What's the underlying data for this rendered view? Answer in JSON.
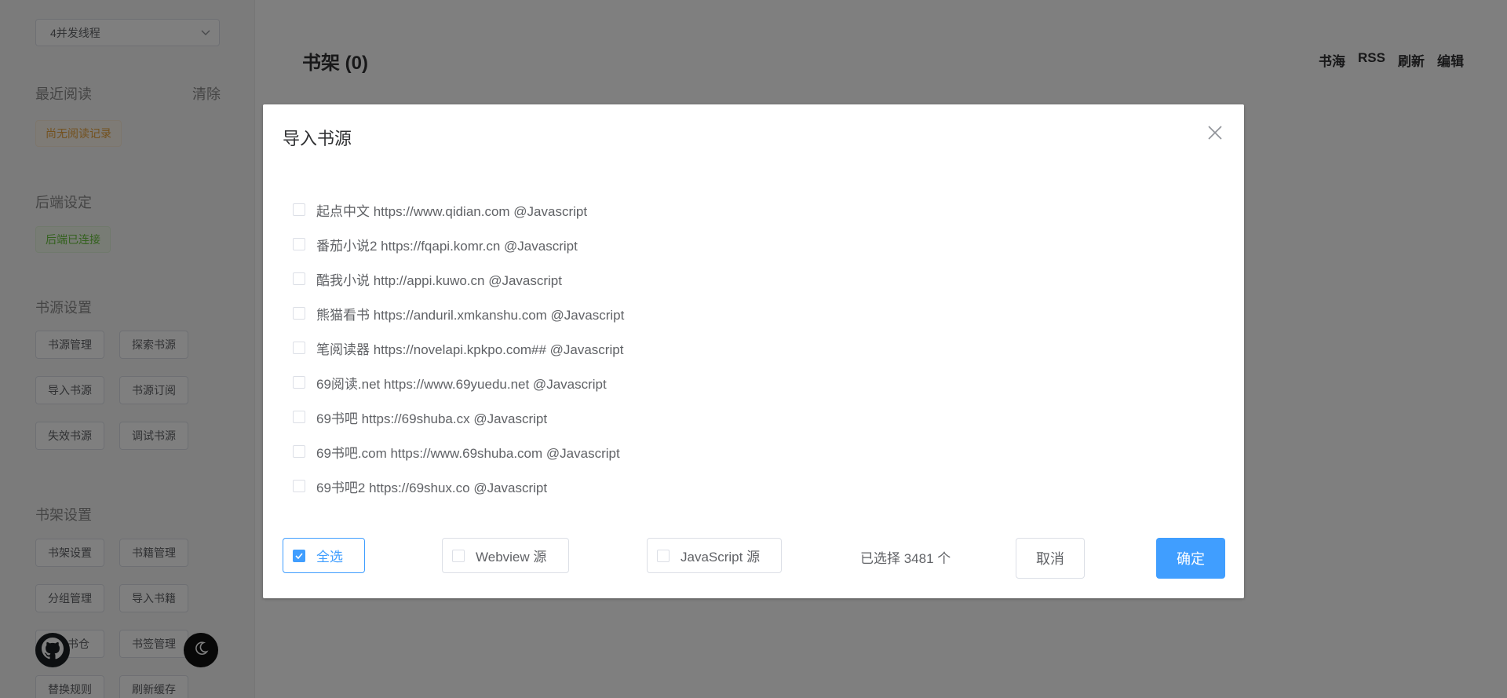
{
  "sidebar": {
    "thread_select": {
      "value": "4并发线程"
    },
    "recent": {
      "title": "最近阅读",
      "clear": "清除",
      "empty_tag": "尚无阅读记录"
    },
    "backend": {
      "title": "后端设定",
      "status_tag": "后端已连接"
    },
    "source_settings": {
      "title": "书源设置",
      "buttons": [
        "书源管理",
        "探索书源",
        "导入书源",
        "书源订阅",
        "失效书源",
        "调试书源"
      ]
    },
    "shelf_settings": {
      "title": "书架设置",
      "buttons": [
        "书架设置",
        "书籍管理",
        "分组管理",
        "导入书籍",
        "书仓",
        "书签管理",
        "替换规则",
        "刷新缓存"
      ]
    }
  },
  "main": {
    "title": "书架 (0)",
    "nav": [
      "书海",
      "RSS",
      "刷新",
      "编辑"
    ]
  },
  "modal": {
    "title": "导入书源",
    "sources": [
      {
        "label": "起点中文 https://www.qidian.com @Javascript",
        "checked": false
      },
      {
        "label": "番茄小说2 https://fqapi.komr.cn @Javascript",
        "checked": false
      },
      {
        "label": "酷我小说 http://appi.kuwo.cn @Javascript",
        "checked": false
      },
      {
        "label": "熊猫看书 https://anduril.xmkanshu.com @Javascript",
        "checked": false
      },
      {
        "label": "笔阅读器 https://novelapi.kpkpo.com## @Javascript",
        "checked": false
      },
      {
        "label": "69阅读.net https://www.69yuedu.net @Javascript",
        "checked": false
      },
      {
        "label": "69书吧 https://69shuba.cx @Javascript",
        "checked": false
      },
      {
        "label": "69书吧.com https://www.69shuba.com @Javascript",
        "checked": false
      },
      {
        "label": "69书吧2 https://69shux.co @Javascript",
        "checked": false
      }
    ],
    "footer": {
      "select_all": "全选",
      "select_all_checked": true,
      "webview": "Webview 源",
      "javascript": "JavaScript 源",
      "selected_count": "已选择 3481 个",
      "cancel": "取消",
      "confirm": "确定"
    }
  },
  "colors": {
    "primary": "#409eff",
    "overlay": "rgba(0,0,0,0.5)"
  }
}
